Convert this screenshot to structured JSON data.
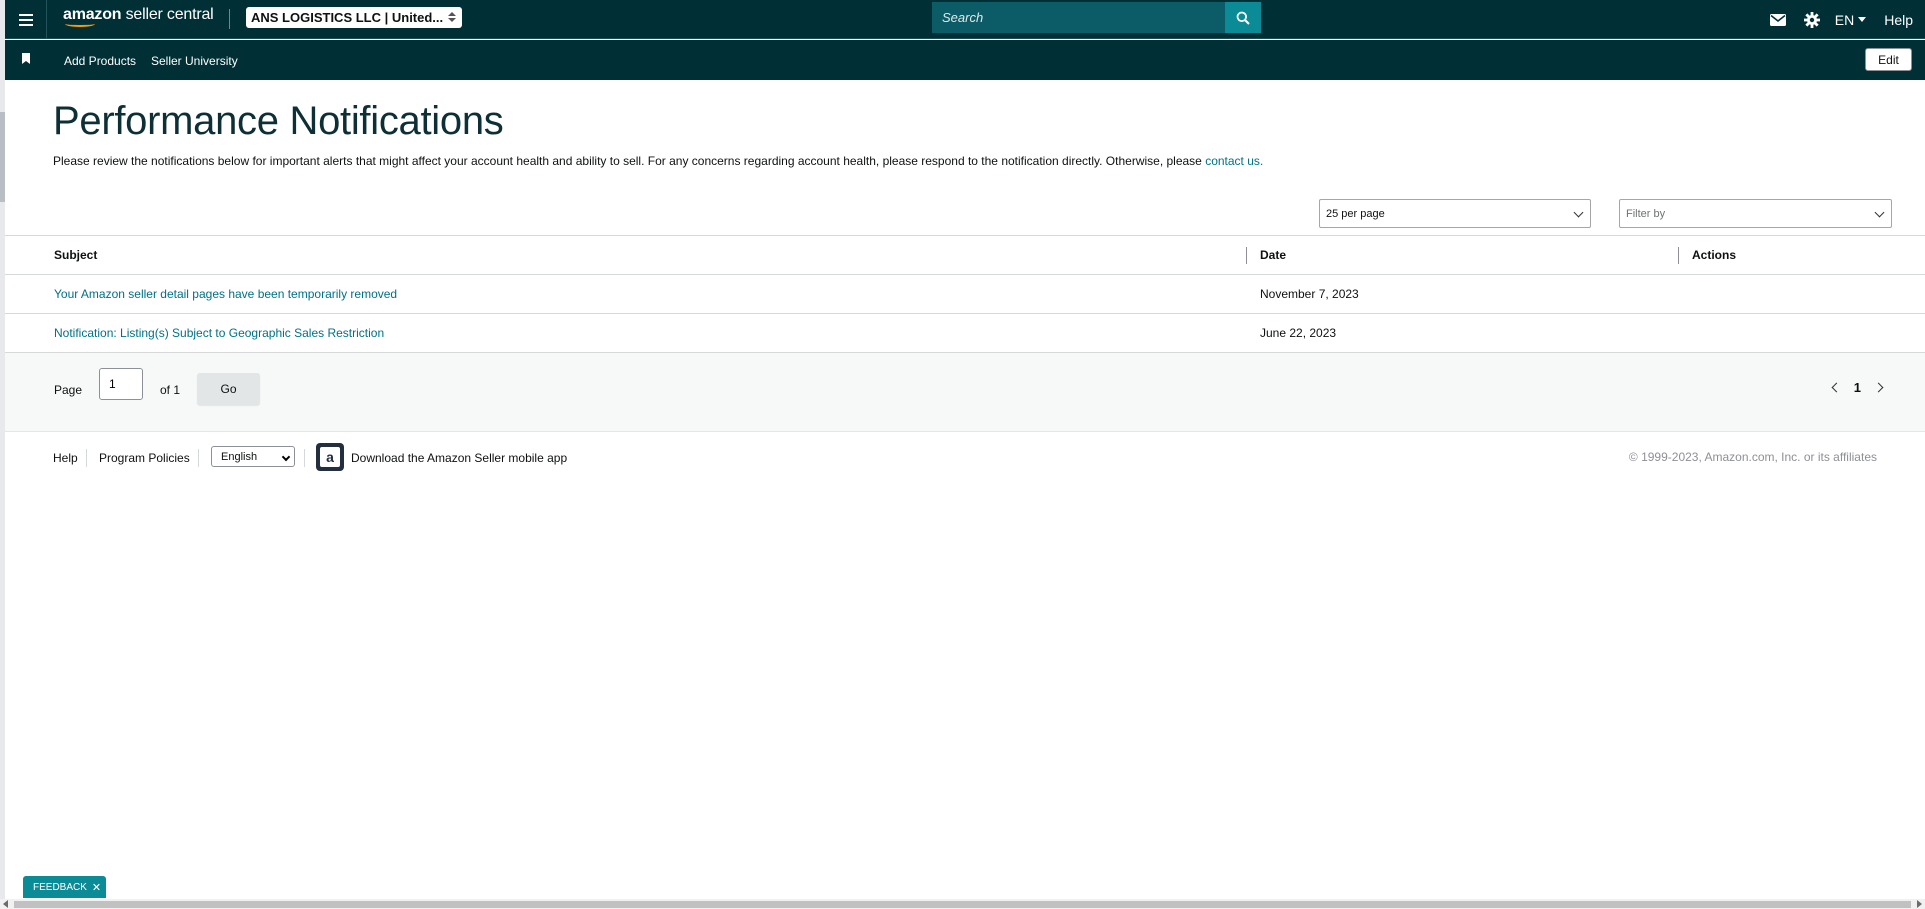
{
  "topbar": {
    "logo_prefix": "amazon",
    "logo_suffix": "seller central",
    "account": "ANS LOGISTICS LLC | United...",
    "search_placeholder": "Search",
    "lang": "EN",
    "help": "Help",
    "icons": [
      "menu-icon",
      "mail-icon",
      "gear-icon",
      "search-icon"
    ]
  },
  "subnav": {
    "links": [
      "Add Products",
      "Seller University"
    ],
    "edit": "Edit"
  },
  "page": {
    "title": "Performance Notifications",
    "intro": "Please review the notifications below for important alerts that might affect your account health and ability to sell. For any concerns regarding account health, please respond to the notification directly. Otherwise, please ",
    "intro_link": "contact us."
  },
  "controls": {
    "per_page": "25 per page",
    "filter_placeholder": "Filter by"
  },
  "table": {
    "headers": [
      "Subject",
      "Date",
      "Actions"
    ],
    "rows": [
      {
        "subject": "Your Amazon seller detail pages have been temporarily removed",
        "date": "November 7, 2023",
        "actions": ""
      },
      {
        "subject": "Notification: Listing(s) Subject to Geographic Sales Restriction",
        "date": "June 22, 2023",
        "actions": ""
      }
    ]
  },
  "pager": {
    "label": "Page",
    "current_value": "1",
    "of": "of 1",
    "go": "Go",
    "current_page": "1"
  },
  "footer": {
    "help": "Help",
    "policies": "Program Policies",
    "language": "English",
    "app_text": "Download the Amazon Seller mobile app",
    "copyright": "© 1999-2023, Amazon.com, Inc. or its affiliates"
  },
  "feedback": "FEEDBACK",
  "colors": {
    "nav_bg": "#002f36",
    "link": "#007185",
    "accent": "#0a8b96"
  }
}
